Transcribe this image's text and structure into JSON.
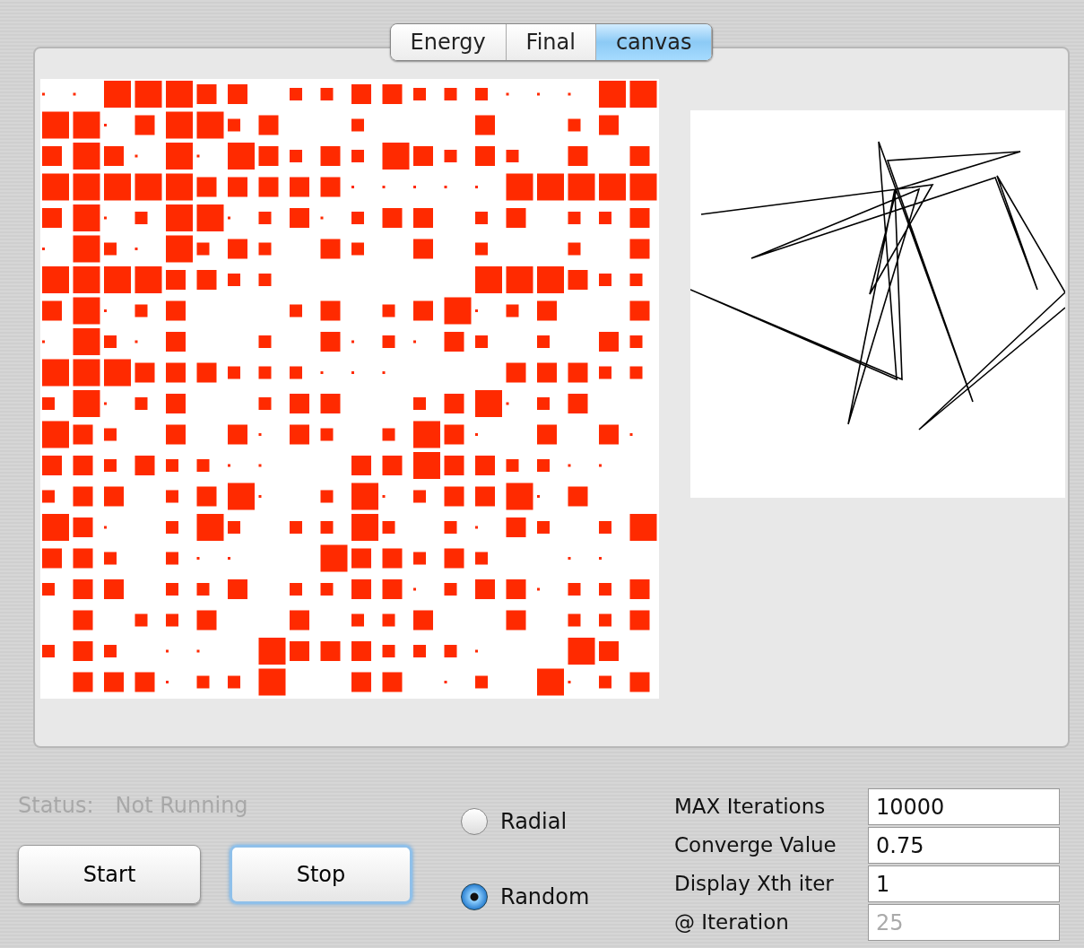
{
  "tabs": [
    {
      "label": "Energy",
      "selected": false
    },
    {
      "label": "Final",
      "selected": false
    },
    {
      "label": "canvas",
      "selected": true
    }
  ],
  "status": {
    "label": "Status:",
    "value": "Not Running",
    "disabled": true
  },
  "buttons": [
    {
      "label": "Start",
      "focused": false
    },
    {
      "label": "Stop",
      "focused": true
    }
  ],
  "layout_options": [
    {
      "label": "Radial",
      "selected": false
    },
    {
      "label": "Random",
      "selected": true
    }
  ],
  "parameters": [
    {
      "label": "MAX Iterations",
      "value": "10000",
      "disabled": false
    },
    {
      "label": "Converge Value",
      "value": "0.75",
      "disabled": false
    },
    {
      "label": "Display Xth iter",
      "value": "1",
      "disabled": false
    },
    {
      "label": "@ Iteration",
      "value": "25",
      "disabled": true
    }
  ]
}
